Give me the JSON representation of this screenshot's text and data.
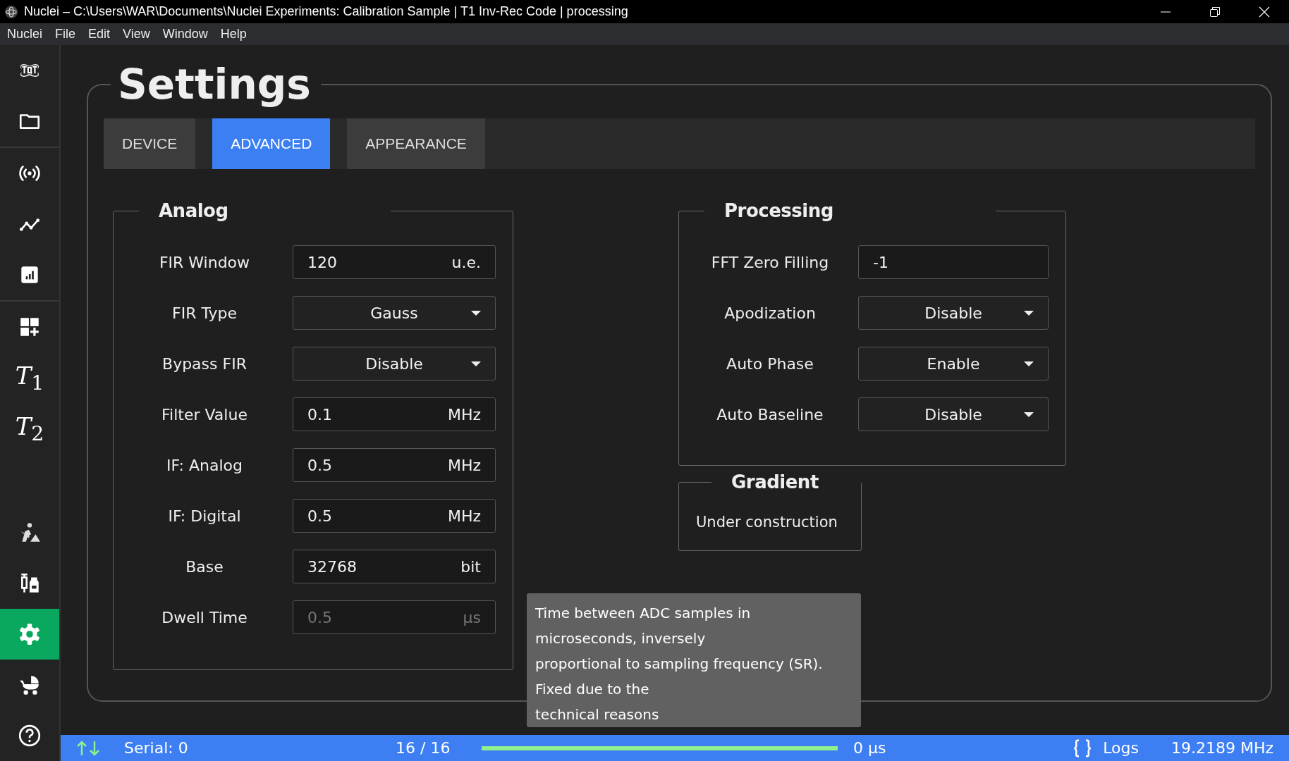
{
  "window": {
    "title": "Nuclei – C:\\Users\\WAR\\Documents\\Nuclei Experiments: Calibration Sample | T1 Inv-Rec Code | processing"
  },
  "menu": [
    "Nuclei",
    "File",
    "Edit",
    "View",
    "Window",
    "Help"
  ],
  "sidebar": {
    "top_groups": [
      [
        {
          "kind": "logo",
          "selected": false
        },
        {
          "kind": "folder",
          "selected": false
        }
      ],
      [
        {
          "kind": "signal",
          "selected": false
        },
        {
          "kind": "line",
          "selected": false
        },
        {
          "kind": "chart",
          "selected": false
        }
      ],
      [
        {
          "kind": "add",
          "selected": false
        },
        {
          "kind": "label",
          "label": "*T*$_{1}$",
          "selected": false
        },
        {
          "kind": "label",
          "label": "*T*$_{2}$",
          "selected": false
        }
      ]
    ],
    "bottom_items": [
      {
        "kind": "worker",
        "selected": false
      },
      {
        "kind": "syringe",
        "selected": false
      },
      {
        "kind": "gear",
        "selected": true
      },
      {
        "kind": "stroller",
        "selected": false
      },
      {
        "kind": "help",
        "selected": false
      }
    ]
  },
  "page": {
    "title": "Settings",
    "tabs": [
      {
        "label": "DEVICE",
        "selected": false
      },
      {
        "label": "ADVANCED",
        "selected": true
      },
      {
        "label": "APPEARANCE",
        "selected": false
      }
    ],
    "panels": [
      {
        "title": "Analog",
        "rows": [
          {
            "kind": "input",
            "label": "FIR Window",
            "value": "120",
            "unit": "u.e.",
            "disabled": false
          },
          {
            "kind": "select",
            "label": "FIR Type",
            "value": "Gauss"
          },
          {
            "kind": "select",
            "label": "Bypass FIR",
            "value": "Disable"
          },
          {
            "kind": "input",
            "label": "Filter Value",
            "value": "0.1",
            "unit": "MHz",
            "disabled": false
          },
          {
            "kind": "input",
            "label": "IF: Analog",
            "value": "0.5",
            "unit": "MHz",
            "disabled": false
          },
          {
            "kind": "input",
            "label": "IF: Digital",
            "value": "0.5",
            "unit": "MHz",
            "disabled": false
          },
          {
            "kind": "input",
            "label": "Base",
            "value": "32768",
            "unit": "bit",
            "disabled": false
          },
          {
            "kind": "input",
            "label": "Dwell Time",
            "value": "0.5",
            "unit": "µs",
            "disabled": true
          }
        ]
      },
      {
        "title": "Processing",
        "rows": [
          {
            "kind": "input",
            "label": "FFT Zero Filling",
            "value": "-1",
            "disabled": false
          },
          {
            "kind": "select",
            "label": "Apodization",
            "value": "Disable"
          },
          {
            "kind": "select",
            "label": "Auto Phase",
            "value": "Enable"
          },
          {
            "kind": "select",
            "label": "Auto Baseline",
            "value": "Disable"
          }
        ]
      }
    ],
    "gradient": {
      "title": "Gradient",
      "text": "Under construction"
    },
    "tooltip": {
      "lines": [
        "Time between ADC samples in",
        "microseconds, inversely",
        "proportional to sampling frequency (SR).",
        "Fixed due to the",
        "technical reasons"
      ]
    }
  },
  "status_bar": {
    "serial": "Serial: 0",
    "count": "16 / 16",
    "progress": {
      "level": 1.0
    },
    "time": "0 µs",
    "logs": "Logs",
    "frequency": "19.2189 MHz"
  }
}
